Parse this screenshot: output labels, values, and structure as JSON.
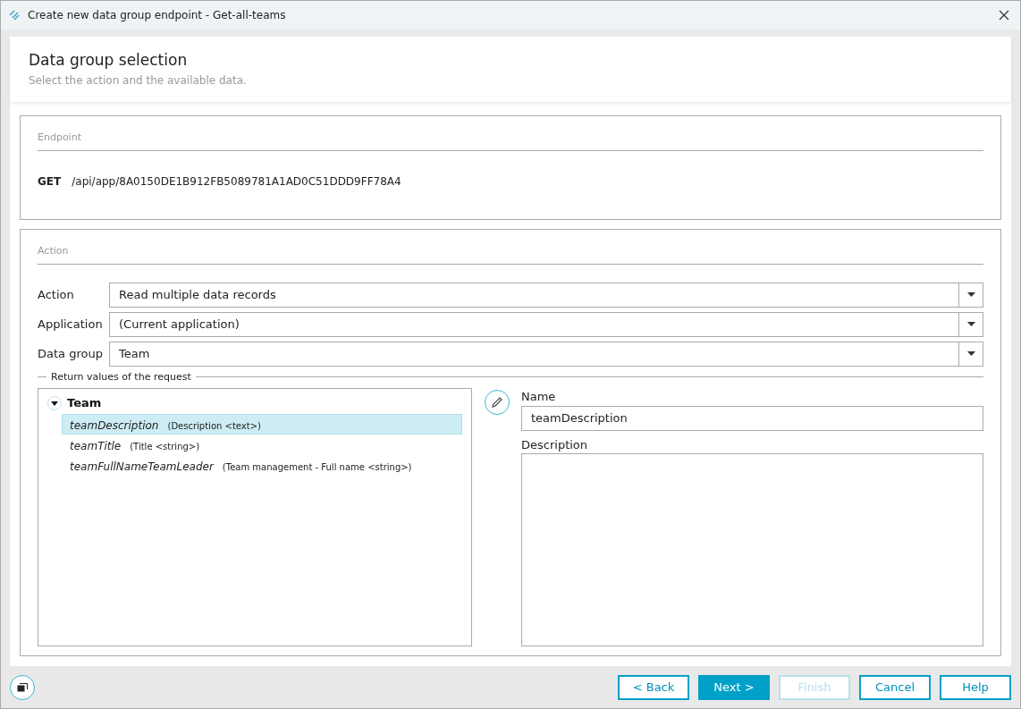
{
  "window": {
    "title": "Create new data group endpoint - Get-all-teams"
  },
  "header": {
    "title": "Data group selection",
    "subtitle": "Select the action and the available data."
  },
  "endpoint": {
    "legend": "Endpoint",
    "method": "GET",
    "path": "/api/app/8A0150DE1B912FB5089781A1AD0C51DDD9FF78A4"
  },
  "action_section": {
    "legend": "Action",
    "fields": [
      {
        "label": "Action",
        "value": "Read multiple data records"
      },
      {
        "label": "Application",
        "value": "(Current application)"
      },
      {
        "label": "Data group",
        "value": "Team"
      }
    ]
  },
  "return_values": {
    "legend": "Return values of the request",
    "tree": {
      "label": "Team",
      "expanded": true,
      "children": [
        {
          "name": "teamDescription",
          "type": "(Description <text>)",
          "selected": true
        },
        {
          "name": "teamTitle",
          "type": "(Title <string>)",
          "selected": false
        },
        {
          "name": "teamFullNameTeamLeader",
          "type": "(Team management - Full name <string>)",
          "selected": false
        }
      ]
    },
    "name_label": "Name",
    "name_value": "teamDescription",
    "description_label": "Description"
  },
  "buttons": [
    {
      "label": "< Back",
      "kind": "outline",
      "disabled": false
    },
    {
      "label": "Next >",
      "kind": "primary",
      "disabled": false
    },
    {
      "label": "Finish",
      "kind": "outline",
      "disabled": true
    },
    {
      "label": "Cancel",
      "kind": "outline",
      "disabled": false
    },
    {
      "label": "Help",
      "kind": "outline",
      "disabled": false
    }
  ]
}
